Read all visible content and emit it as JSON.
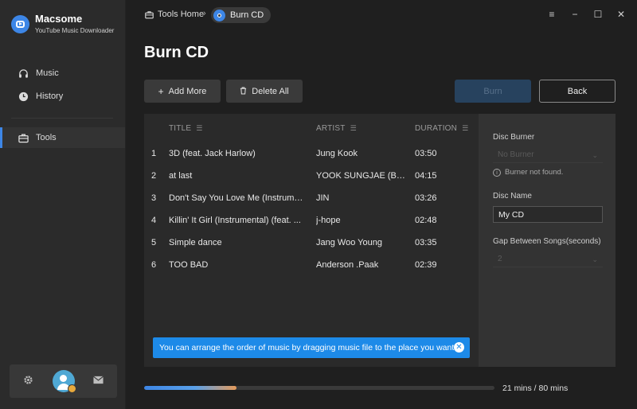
{
  "app": {
    "name": "Macsome",
    "subtitle": "YouTube Music Downloader"
  },
  "sidebar": {
    "items": [
      {
        "label": "Music",
        "icon": "headphones-icon"
      },
      {
        "label": "History",
        "icon": "clock-icon"
      },
      {
        "label": "Tools",
        "icon": "toolbox-icon",
        "active": true
      }
    ],
    "bottom_icons": [
      "gear-icon",
      "user-avatar",
      "mail-icon"
    ]
  },
  "breadcrumb": {
    "home": "Tools Home",
    "current": "Burn CD"
  },
  "page": {
    "title": "Burn CD"
  },
  "toolbar": {
    "add_more": "Add More",
    "delete_all": "Delete All",
    "burn": "Burn",
    "back": "Back"
  },
  "table": {
    "headers": {
      "title": "TITLE",
      "artist": "ARTIST",
      "duration": "DURATION"
    },
    "rows": [
      {
        "index": "1",
        "title": "3D (feat. Jack Harlow)",
        "artist": "Jung Kook",
        "duration": "03:50"
      },
      {
        "index": "2",
        "title": "at last",
        "artist": "YOOK SUNGJAE (BT...",
        "duration": "04:15"
      },
      {
        "index": "3",
        "title": "Don't Say You Love Me (Instrume...",
        "artist": "JIN",
        "duration": "03:26"
      },
      {
        "index": "4",
        "title": "Killin' It Girl (Instrumental) (feat. ...",
        "artist": "j-hope",
        "duration": "02:48"
      },
      {
        "index": "5",
        "title": "Simple dance",
        "artist": "Jang Woo Young",
        "duration": "03:35"
      },
      {
        "index": "6",
        "title": "TOO BAD",
        "artist": "Anderson .Paak",
        "duration": "02:39"
      }
    ]
  },
  "tip": {
    "text": "You can arrange the order of music by dragging music file to the place you want."
  },
  "settings": {
    "disc_burner_label": "Disc Burner",
    "disc_burner_value": "No Burner",
    "burner_warning": "Burner not found.",
    "disc_name_label": "Disc Name",
    "disc_name_value": "My CD",
    "gap_label": "Gap Between Songs(seconds)",
    "gap_value": "2"
  },
  "progress": {
    "used_minutes": 21,
    "total_minutes": 80,
    "text": "21 mins / 80 mins"
  },
  "colors": {
    "accent": "#3d86e6",
    "tip_bg": "#1d8ae8",
    "progress_end": "#e59a5a"
  }
}
